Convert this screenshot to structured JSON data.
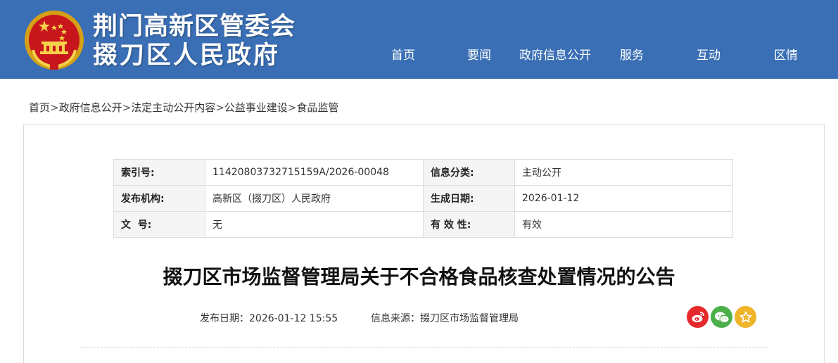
{
  "header": {
    "title_line1": "荆门高新区管委会",
    "title_line2": "掇刀区人民政府",
    "emblem_icon": "national-emblem-icon",
    "background_color": "#3a6fb5"
  },
  "nav": [
    {
      "label": "首页"
    },
    {
      "label": "要闻"
    },
    {
      "label": "政府信息公开"
    },
    {
      "label": "服务"
    },
    {
      "label": "互动"
    },
    {
      "label": "区情"
    }
  ],
  "breadcrumb": {
    "items": [
      "首页",
      "政府信息公开",
      "法定主动公开内容",
      "公益事业建设",
      "食品监管"
    ],
    "separator": ">"
  },
  "meta": {
    "index_label": "索引号:",
    "index_value": "11420803732715159A/2026-00048",
    "category_label": "信息分类:",
    "category_value": "主动公开",
    "publisher_label": "发布机构:",
    "publisher_value": "高新区（掇刀区）人民政府",
    "date_label": "生成日期:",
    "date_value": "2026-01-12",
    "docno_label": "文  号:",
    "docno_value": "无",
    "validity_label": "有 效 性:",
    "validity_value": "有效"
  },
  "article": {
    "title": "掇刀区市场监督管理局关于不合格食品核查处置情况的公告",
    "publish_date": "发布日期：2026-01-12 15:55",
    "source": "信息来源：掇刀区市场监督管理局"
  },
  "share": {
    "weibo_color": "#e6292a",
    "wechat_color": "#4cb04a",
    "favorite_color": "#f0b429"
  }
}
